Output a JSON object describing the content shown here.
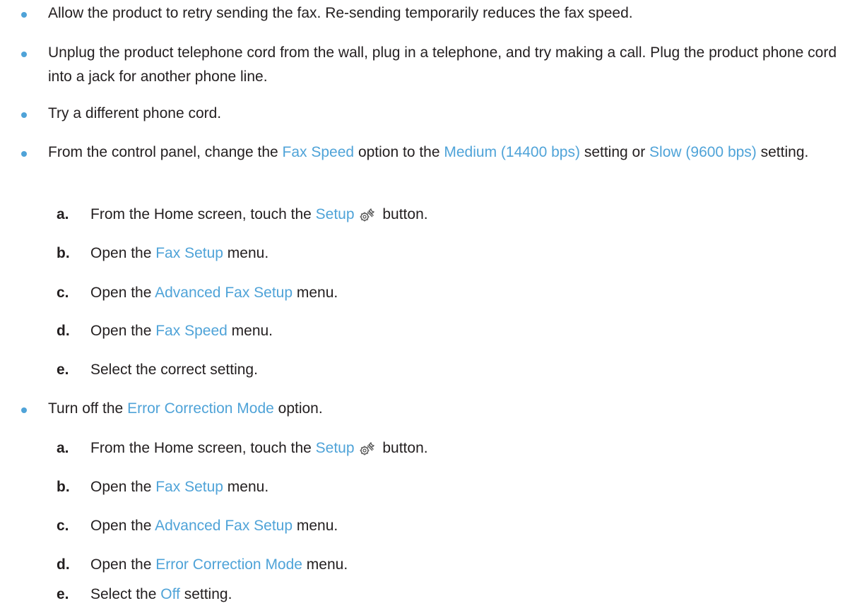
{
  "bullets": [
    {
      "text": "Allow the product to retry sending the fax. Re-sending temporarily reduces the fax speed."
    },
    {
      "text": "Unplug the product telephone cord from the wall, plug in a telephone, and try making a call. Plug the product phone cord into a jack for another phone line."
    },
    {
      "text": "Try a different phone cord."
    },
    {
      "t1": "From the control panel, change the ",
      "k1": "Fax Speed",
      "t2": " option to the ",
      "k2": "Medium (14400 bps)",
      "t3": " setting or ",
      "k3": "Slow (9600 bps)",
      "t4": " setting.",
      "steps": [
        {
          "letter": "a.",
          "t1": "From the Home screen, touch the ",
          "k1": "Setup",
          "icon": "setup-wrench-gear-icon",
          "t2": " button."
        },
        {
          "letter": "b.",
          "t1": "Open the ",
          "k1": "Fax Setup",
          "t2": " menu."
        },
        {
          "letter": "c.",
          "t1": "Open the ",
          "k1": "Advanced Fax Setup",
          "t2": " menu."
        },
        {
          "letter": "d.",
          "t1": "Open the ",
          "k1": "Fax Speed",
          "t2": " menu."
        },
        {
          "letter": "e.",
          "t1": "Select the correct setting."
        }
      ]
    },
    {
      "t1": "Turn off the ",
      "k1": "Error Correction Mode",
      "t2": " option.",
      "steps": [
        {
          "letter": "a.",
          "t1": "From the Home screen, touch the ",
          "k1": "Setup",
          "icon": "setup-wrench-gear-icon",
          "t2": " button."
        },
        {
          "letter": "b.",
          "t1": "Open the ",
          "k1": "Fax Setup",
          "t2": " menu."
        },
        {
          "letter": "c.",
          "t1": "Open the ",
          "k1": "Advanced Fax Setup",
          "t2": " menu."
        },
        {
          "letter": "d.",
          "t1": "Open the ",
          "k1": "Error Correction Mode",
          "t2": " menu."
        },
        {
          "letter": "e.",
          "t1": "Select the ",
          "k1": "Off",
          "t2": " setting."
        }
      ]
    }
  ],
  "colors": {
    "text": "#231f20",
    "keyword": "#4fa3d8",
    "bullet": "#4fa3d8"
  }
}
